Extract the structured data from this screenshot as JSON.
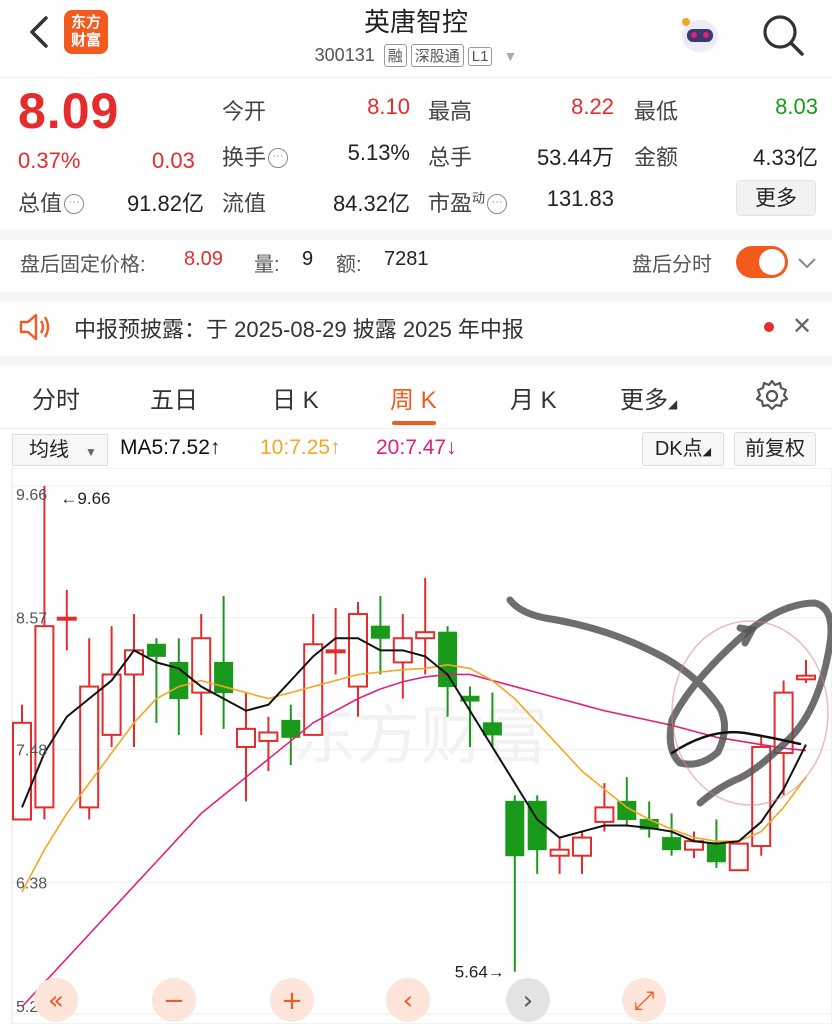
{
  "header": {
    "logo_line1": "东方",
    "logo_line2": "财富",
    "title": "英唐智控",
    "code": "300131",
    "tags": [
      "融",
      "深股通",
      "L1"
    ]
  },
  "quote": {
    "price": "8.09",
    "pct": "0.37%",
    "change": "0.03",
    "fields": {
      "open_label": "今开",
      "open": "8.10",
      "high_label": "最高",
      "high": "8.22",
      "low_label": "最低",
      "low": "8.03",
      "turnover_label": "换手",
      "turnover": "5.13%",
      "volume_label": "总手",
      "volume": "53.44万",
      "amount_label": "金额",
      "amount": "4.33亿",
      "mktcap_label": "总值",
      "mktcap": "91.82亿",
      "float_label": "流值",
      "float": "84.32亿",
      "pe_label": "市盈",
      "pe_sup": "动",
      "pe": "131.83"
    },
    "more_label": "更多"
  },
  "after_hours": {
    "label": "盘后固定价格:",
    "price": "8.09",
    "vol_label": "量:",
    "vol": "9",
    "amt_label": "额:",
    "amt": "7281",
    "timeshare_label": "盘后分时"
  },
  "notice": {
    "text": "中报预披露：于 2025-08-29 披露 2025 年中报"
  },
  "tabs": [
    {
      "label": "分时"
    },
    {
      "label": "五日"
    },
    {
      "label": "日 K"
    },
    {
      "label": "周 K"
    },
    {
      "label": "月 K"
    },
    {
      "label": "更多"
    }
  ],
  "toolbar": {
    "ma_select": "均线",
    "ma5": "MA5:7.52↑",
    "ma10": "10:7.25↑",
    "ma20": "20:7.47↓",
    "dk": "DK点",
    "adjust": "前复权"
  },
  "colors": {
    "up": "#e52b2b",
    "down": "#1a9a1a",
    "ma5": "#111111",
    "ma10": "#f5a623",
    "ma20": "#e0207a",
    "accent": "#f25a1e"
  },
  "chart_data": {
    "type": "candlestick",
    "y_ticks": [
      "9.66",
      "8.57",
      "7.48",
      "6.38",
      "5.29"
    ],
    "ylim": [
      5.29,
      9.66
    ],
    "max_marker": "←9.66",
    "min_marker": "5.64→",
    "watermark": "东方财富",
    "candles": [
      {
        "o": 6.9,
        "c": 7.7,
        "h": 7.85,
        "l": 6.9
      },
      {
        "o": 7.0,
        "c": 8.5,
        "h": 9.66,
        "l": 6.9
      },
      {
        "o": 8.57,
        "c": 8.57,
        "h": 8.8,
        "l": 8.3
      },
      {
        "o": 7.0,
        "c": 8.0,
        "h": 8.4,
        "l": 6.9
      },
      {
        "o": 7.6,
        "c": 8.1,
        "h": 8.5,
        "l": 7.5
      },
      {
        "o": 8.1,
        "c": 8.3,
        "h": 8.6,
        "l": 7.5
      },
      {
        "o": 8.35,
        "c": 8.25,
        "h": 8.4,
        "l": 7.7
      },
      {
        "o": 8.2,
        "c": 7.9,
        "h": 8.4,
        "l": 7.6
      },
      {
        "o": 7.95,
        "c": 8.4,
        "h": 8.6,
        "l": 7.6
      },
      {
        "o": 8.2,
        "c": 7.95,
        "h": 8.75,
        "l": 7.65
      },
      {
        "o": 7.5,
        "c": 7.65,
        "h": 7.95,
        "l": 7.05
      },
      {
        "o": 7.55,
        "c": 7.62,
        "h": 7.75,
        "l": 7.3
      },
      {
        "o": 7.72,
        "c": 7.58,
        "h": 7.85,
        "l": 7.35
      },
      {
        "o": 7.6,
        "c": 8.35,
        "h": 8.6,
        "l": 7.6
      },
      {
        "o": 8.3,
        "c": 8.3,
        "h": 8.65,
        "l": 8.1
      },
      {
        "o": 8.0,
        "c": 8.6,
        "h": 8.7,
        "l": 7.75
      },
      {
        "o": 8.5,
        "c": 8.4,
        "h": 8.75,
        "l": 8.1
      },
      {
        "o": 8.2,
        "c": 8.4,
        "h": 8.6,
        "l": 7.9
      },
      {
        "o": 8.4,
        "c": 8.45,
        "h": 8.9,
        "l": 8.1
      },
      {
        "o": 8.45,
        "c": 8.0,
        "h": 8.5,
        "l": 7.75
      },
      {
        "o": 7.92,
        "c": 7.88,
        "h": 8.0,
        "l": 7.5
      },
      {
        "o": 7.7,
        "c": 7.6,
        "h": 7.95,
        "l": 7.5
      },
      {
        "o": 7.05,
        "c": 6.6,
        "h": 7.1,
        "l": 5.64
      },
      {
        "o": 7.05,
        "c": 6.65,
        "h": 7.1,
        "l": 6.45
      },
      {
        "o": 6.6,
        "c": 6.65,
        "h": 6.75,
        "l": 6.45
      },
      {
        "o": 6.6,
        "c": 6.75,
        "h": 6.8,
        "l": 6.45
      },
      {
        "o": 6.88,
        "c": 7.0,
        "h": 7.2,
        "l": 6.8
      },
      {
        "o": 7.05,
        "c": 6.9,
        "h": 7.25,
        "l": 6.85
      },
      {
        "o": 6.9,
        "c": 6.82,
        "h": 7.05,
        "l": 6.75
      },
      {
        "o": 6.75,
        "c": 6.65,
        "h": 6.95,
        "l": 6.6
      },
      {
        "o": 6.65,
        "c": 6.72,
        "h": 6.8,
        "l": 6.58
      },
      {
        "o": 6.7,
        "c": 6.55,
        "h": 6.9,
        "l": 6.5
      },
      {
        "o": 6.48,
        "c": 6.7,
        "h": 6.7,
        "l": 6.48
      },
      {
        "o": 6.68,
        "c": 7.5,
        "h": 7.6,
        "l": 6.6
      },
      {
        "o": 7.45,
        "c": 7.95,
        "h": 8.05,
        "l": 7.1
      },
      {
        "o": 8.06,
        "c": 8.09,
        "h": 8.22,
        "l": 8.03
      }
    ],
    "ma5": [
      7.0,
      7.45,
      7.75,
      7.9,
      8.05,
      8.3,
      8.2,
      8.15,
      8.0,
      7.9,
      7.8,
      7.85,
      8.05,
      8.25,
      8.4,
      8.4,
      8.3,
      8.3,
      8.25,
      8.1,
      7.8,
      7.5,
      7.2,
      6.9,
      6.75,
      6.8,
      6.85,
      6.85,
      6.83,
      6.8,
      6.72,
      6.7,
      6.72,
      6.88,
      7.15,
      7.52
    ],
    "ma10": [
      6.3,
      6.65,
      6.95,
      7.2,
      7.45,
      7.7,
      7.9,
      8.0,
      8.05,
      8.0,
      7.95,
      7.9,
      7.95,
      8.0,
      8.05,
      8.1,
      8.12,
      8.14,
      8.15,
      8.18,
      8.15,
      8.05,
      7.9,
      7.7,
      7.5,
      7.3,
      7.15,
      7.0,
      6.9,
      6.82,
      6.75,
      6.72,
      6.72,
      6.8,
      7.0,
      7.25
    ],
    "ma20": [
      5.35,
      5.55,
      5.75,
      5.95,
      6.15,
      6.35,
      6.55,
      6.75,
      6.95,
      7.1,
      7.25,
      7.4,
      7.55,
      7.7,
      7.8,
      7.9,
      7.98,
      8.04,
      8.08,
      8.1,
      8.1,
      8.05,
      8.0,
      7.95,
      7.9,
      7.85,
      7.8,
      7.76,
      7.72,
      7.68,
      7.63,
      7.58,
      7.55,
      7.52,
      7.49,
      7.47
    ]
  },
  "controls": [
    "«",
    "−",
    "+",
    "‹",
    "›",
    "⤢"
  ]
}
